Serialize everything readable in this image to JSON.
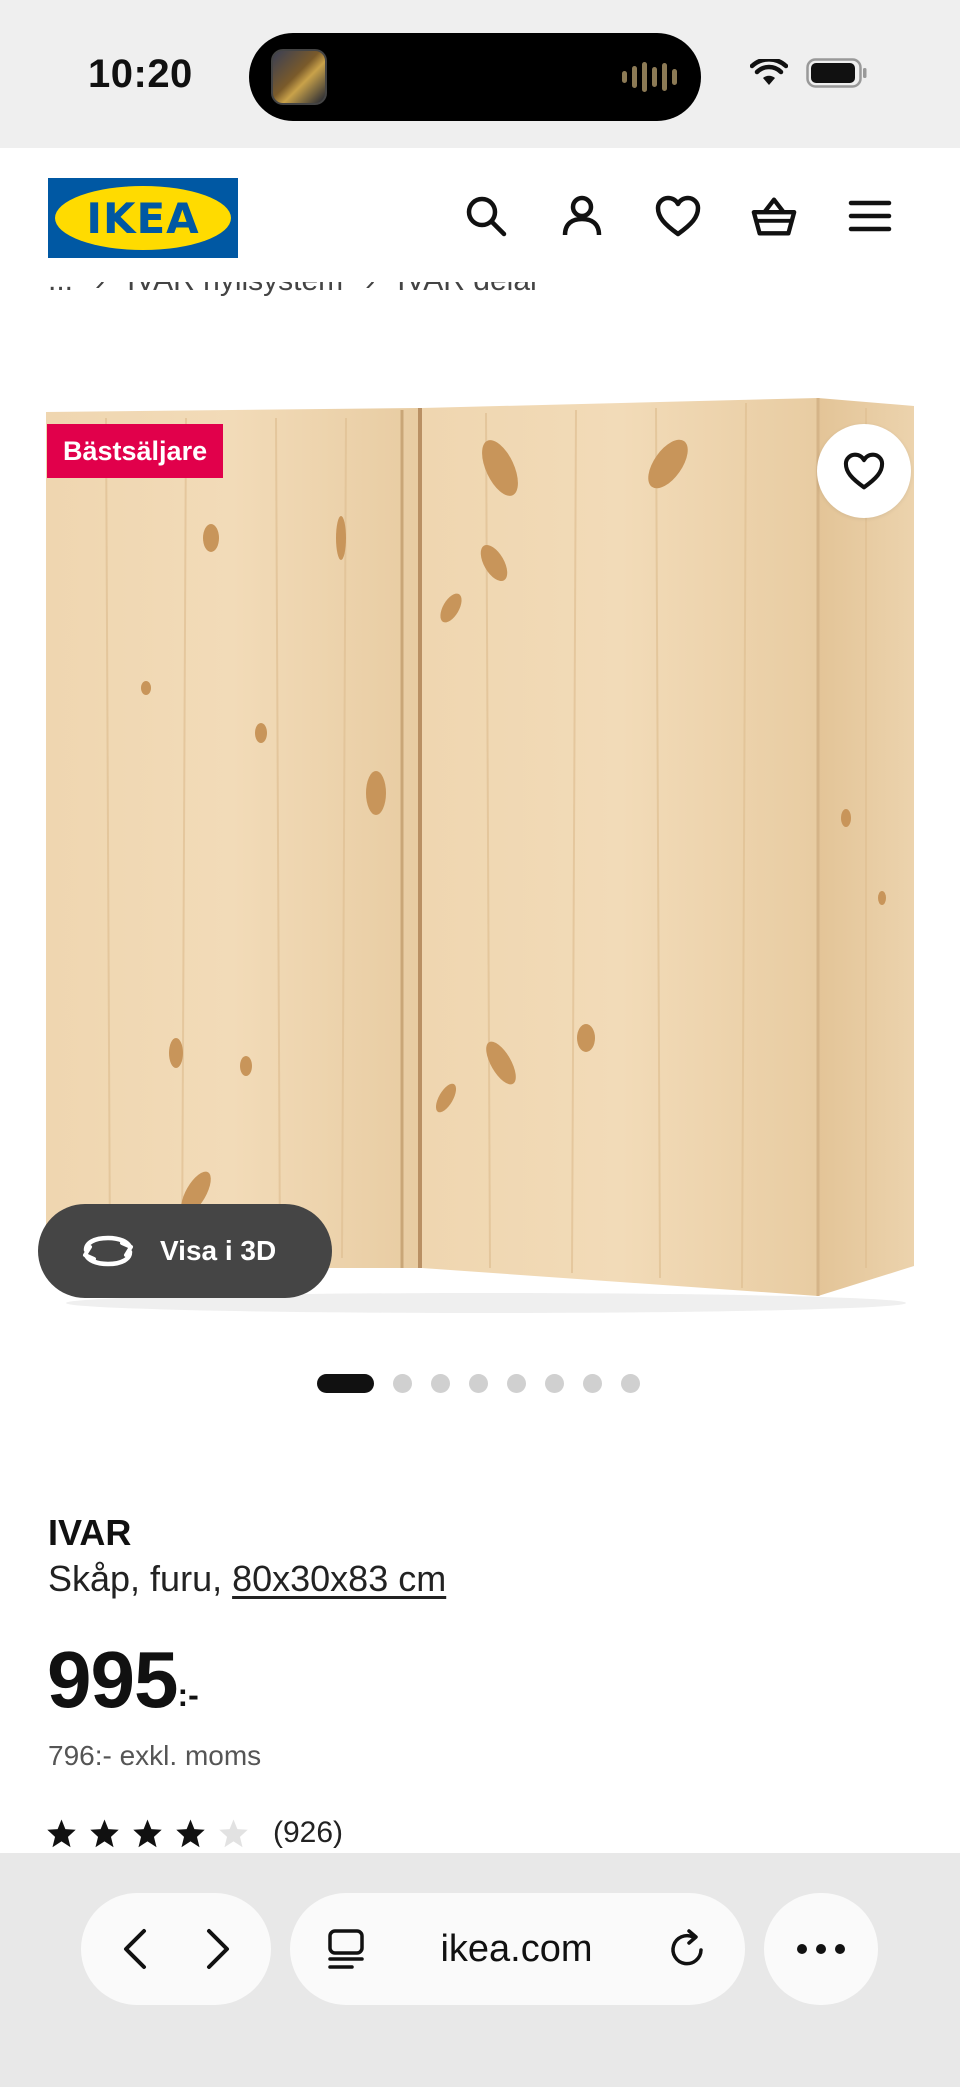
{
  "status_bar": {
    "time": "10:20"
  },
  "header": {
    "logo_text": "IKEA"
  },
  "breadcrumb": {
    "items": [
      "...",
      "IVAR hyllsystem",
      "IVAR delar"
    ]
  },
  "product_image": {
    "badge": "Bästsäljare",
    "view_3d_label": "Visa i 3D",
    "image_count": 8,
    "active_index": 0
  },
  "product": {
    "name": "IVAR",
    "description": "Skåp, furu,",
    "size": "80x30x83 cm",
    "price": "995",
    "price_suffix": ":-",
    "price_ex_vat": "796:- exkl. moms",
    "rating": 4,
    "rating_max": 5,
    "review_count": "(926)"
  },
  "browser": {
    "url": "ikea.com"
  },
  "colors": {
    "ikea_blue": "#0058a3",
    "ikea_yellow": "#ffdb00",
    "badge_red": "#e1004b",
    "wood": "#ecd3ad"
  }
}
